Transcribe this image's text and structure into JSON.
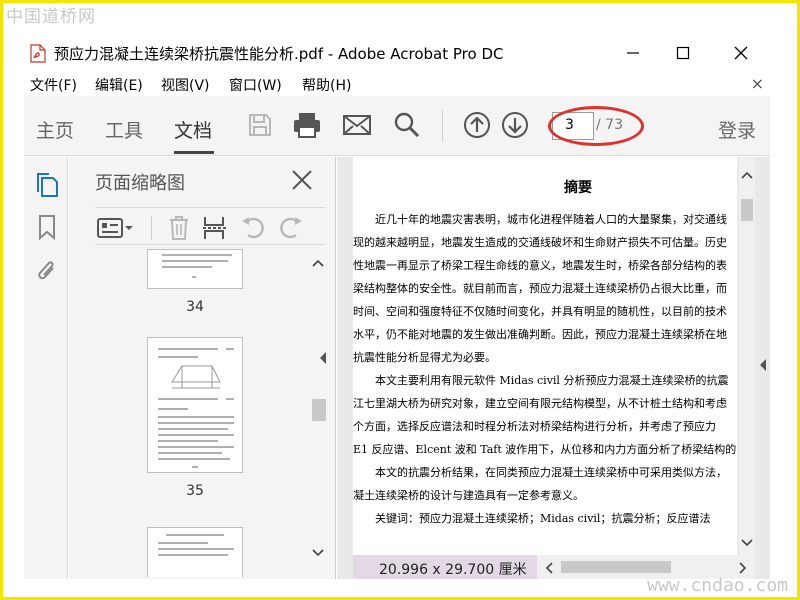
{
  "watermark": {
    "top_left": "中国道桥网",
    "bottom_right": "www.cndao.com"
  },
  "window": {
    "title": "预应力混凝土连续梁桥抗震性能分析.pdf - Adobe Acrobat Pro DC",
    "min_icon": "minimize-icon",
    "max_icon": "maximize-icon",
    "close_icon": "close-icon"
  },
  "menu": {
    "items": [
      "文件(F)",
      "编辑(E)",
      "视图(V)",
      "窗口(W)",
      "帮助(H)"
    ],
    "close_label": "×"
  },
  "toolbar": {
    "tabs": [
      "主页",
      "工具",
      "文档"
    ],
    "active_tab": "文档",
    "icons": [
      "save-icon",
      "print-icon",
      "email-icon",
      "search-icon",
      "page-up-icon",
      "page-down-icon"
    ],
    "current_page": "3",
    "total_pages": "/ 73",
    "login_label": "登录",
    "highlight_color": "#e0322b"
  },
  "left_rail": {
    "icons": [
      "page-thumbnails-icon",
      "bookmarks-icon",
      "attachments-icon"
    ]
  },
  "panel": {
    "title": "页面缩略图",
    "tools": [
      "thumbnail-options-icon",
      "delete-page-icon",
      "insert-page-icon",
      "rotate-left-icon",
      "rotate-right-icon"
    ],
    "thumbnails": [
      {
        "page": "34"
      },
      {
        "page": "35"
      },
      {
        "page": ""
      }
    ]
  },
  "document": {
    "heading": "摘要",
    "lines": [
      "　　近几十年的地震灾害表明，城市化进程伴随着人口的大量聚集，对交通线",
      "现的越来越明显，地震发生造成的交通线破坏和生命财产损失不可估量。历史",
      "性地震一再显示了桥梁工程生命线的意义，地震发生时，桥梁各部分结构的表",
      "梁结构整体的安全性。就目前而言，预应力混凝土连续梁桥仍占很大比重，而",
      "时间、空间和强度特征不仅随时间变化，并具有明显的随机性，以目前的技术",
      "水平，仍不能对地震的发生做出准确判断。因此，预应力混凝土连续梁桥在地",
      "抗震性能分析显得尤为必要。",
      "　　本文主要利用有限元软件 Midas civil 分析预应力混凝土连续梁桥的抗震",
      "江七里湖大桥为研究对象，建立空间有限元结构模型，从不计桩土结构和考虑",
      "个方面，选择反应谱法和时程分析法对桥梁结构进行分析，并考虑了预应力",
      "E1 反应谱、Elcent 波和 Taft 波作用下，从位移和内力方面分析了桥梁结构的",
      "　　本文的抗震分析结果，在同类预应力混凝土连续梁桥中可采用类似方法，",
      "凝土连续梁桥的设计与建造具有一定参考意义。",
      "　　关键词：预应力混凝土连续梁桥；Midas civil；抗震分析；反应谱法"
    ],
    "page_size": "20.996 x 29.700 厘米"
  }
}
